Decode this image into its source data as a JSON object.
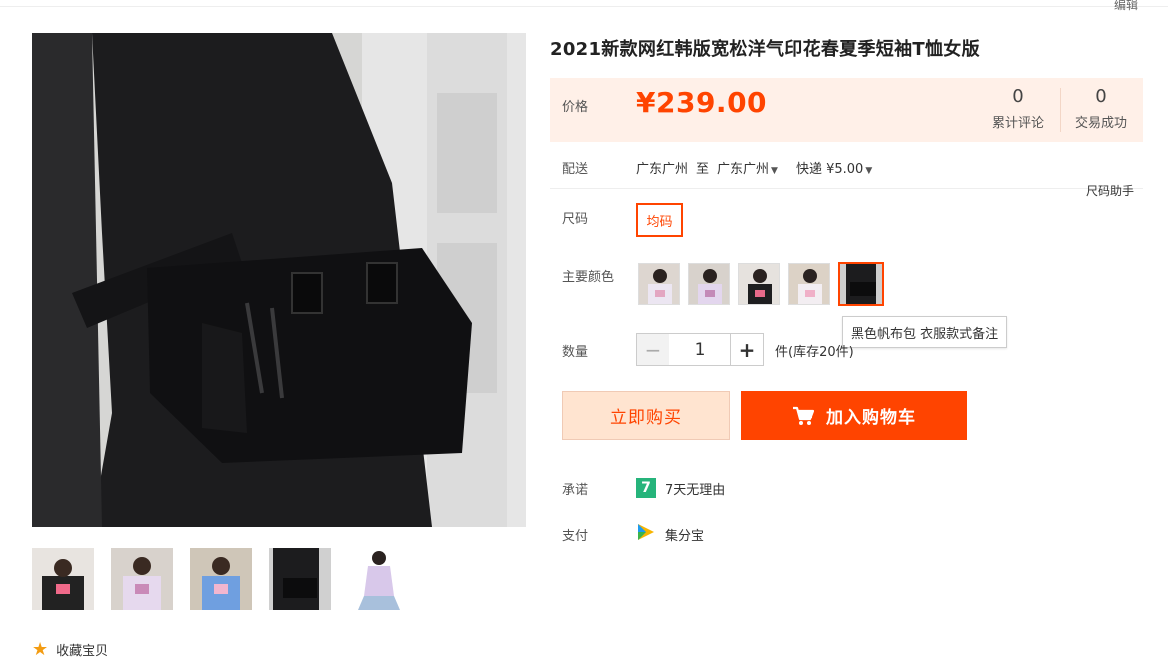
{
  "header": {
    "edit_label": "编辑"
  },
  "product": {
    "title": "2021新款网红韩版宽松洋气印花春夏季短袖T恤女版",
    "price_label": "价格",
    "price": "¥239.00",
    "stats": [
      {
        "value": "0",
        "label": "累计评论"
      },
      {
        "value": "0",
        "label": "交易成功"
      }
    ]
  },
  "shipping": {
    "label": "配送",
    "from": "广东广州",
    "to_word": "至",
    "to": "广东广州",
    "method": "快递 ¥5.00"
  },
  "size": {
    "label": "尺码",
    "helper": "尺码助手",
    "options": [
      "均码"
    ],
    "selected": "均码"
  },
  "color": {
    "label": "主要颜色",
    "tooltip": "黑色帆布包 衣服款式备注",
    "swatch_count": 5,
    "selected_index": 4
  },
  "quantity": {
    "label": "数量",
    "value": "1",
    "stock_text": "件(库存20件)"
  },
  "actions": {
    "buy_now": "立即购买",
    "add_to_cart": "加入购物车"
  },
  "promise": {
    "label": "承诺",
    "icon_text": "7",
    "text": "7天无理由"
  },
  "payment": {
    "label": "支付",
    "text": "集分宝"
  },
  "favorite": {
    "text": "收藏宝贝"
  },
  "colors": {
    "accent": "#ff4400",
    "price_bg": "#fff0e8",
    "buy_now_bg": "#ffe4d0",
    "promise_icon": "#26b47b",
    "star": "#f39c12"
  }
}
